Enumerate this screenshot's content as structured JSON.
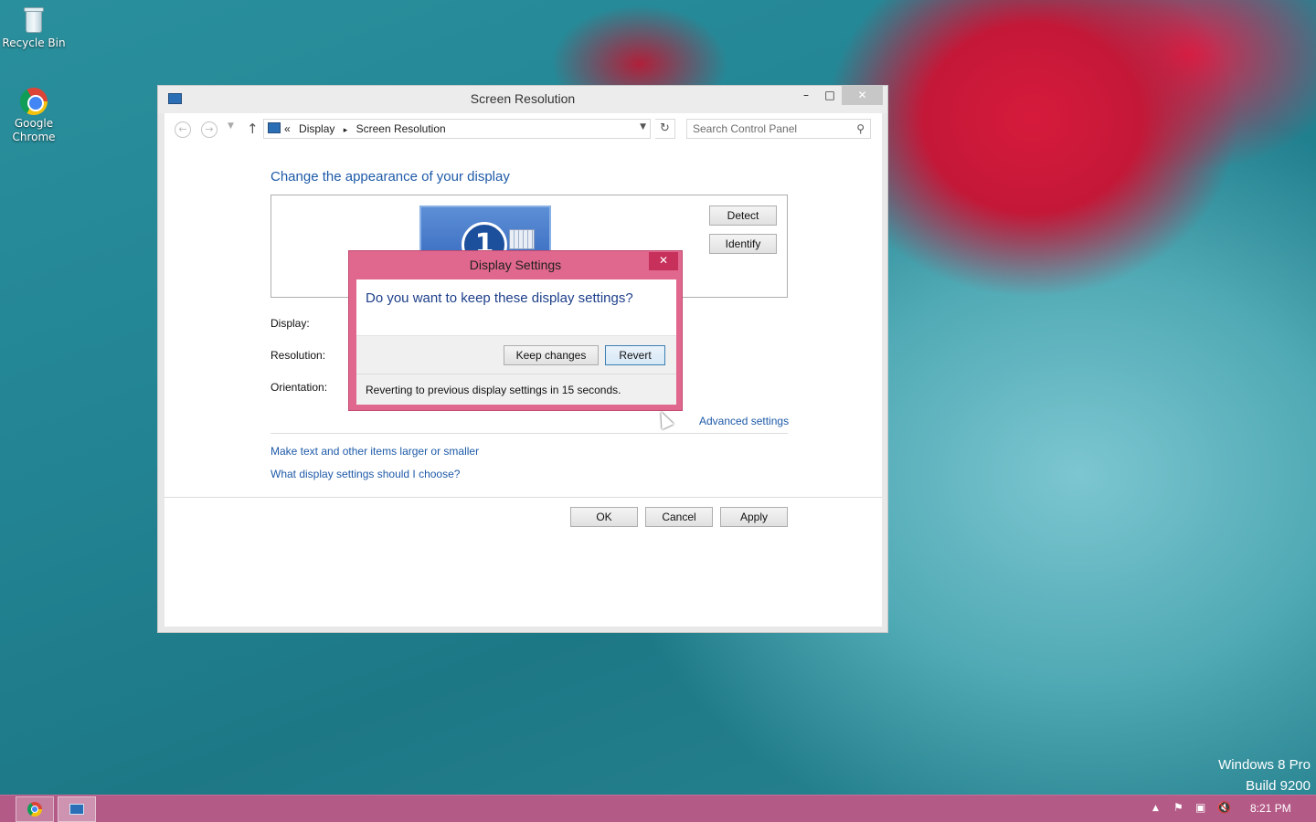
{
  "desktop": {
    "icons": [
      {
        "label": "Recycle Bin",
        "icon": "recycle-bin-icon"
      },
      {
        "label": "Google\nChrome",
        "icon": "chrome-icon"
      }
    ],
    "watermark": {
      "line1": "Windows 8 Pro",
      "line2": "Build 9200"
    }
  },
  "window": {
    "title": "Screen Resolution",
    "controls": {
      "minimize": "–",
      "maximize": "□",
      "close": "✕"
    },
    "address": {
      "prefix": "«",
      "crumbs": [
        "Display",
        "Screen Resolution"
      ],
      "separator": "▸"
    },
    "search": {
      "placeholder": "Search Control Panel"
    },
    "heading": "Change the appearance of your display",
    "monitor_number": "1",
    "buttons": {
      "detect": "Detect",
      "identify": "Identify",
      "ok": "OK",
      "cancel": "Cancel",
      "apply": "Apply"
    },
    "labels": {
      "display": "Display:",
      "resolution": "Resolution:",
      "orientation": "Orientation:"
    },
    "links": {
      "advanced": "Advanced settings",
      "text_size": "Make text and other items larger or smaller",
      "help": "What display settings should I choose?"
    }
  },
  "dialog": {
    "title": "Display Settings",
    "close": "✕",
    "question": "Do you want to keep these display settings?",
    "keep_label": "Keep changes",
    "revert_label": "Revert",
    "status": "Reverting to previous display settings in 15 seconds."
  },
  "taskbar": {
    "clock": "8:21 PM",
    "tray_icons": [
      "show-hidden-icons-icon",
      "action-center-flag-icon",
      "network-icon",
      "volume-muted-icon"
    ]
  },
  "colors": {
    "accent": "#e0678d",
    "taskbar": "#b45a86",
    "link": "#1e5aa8"
  }
}
